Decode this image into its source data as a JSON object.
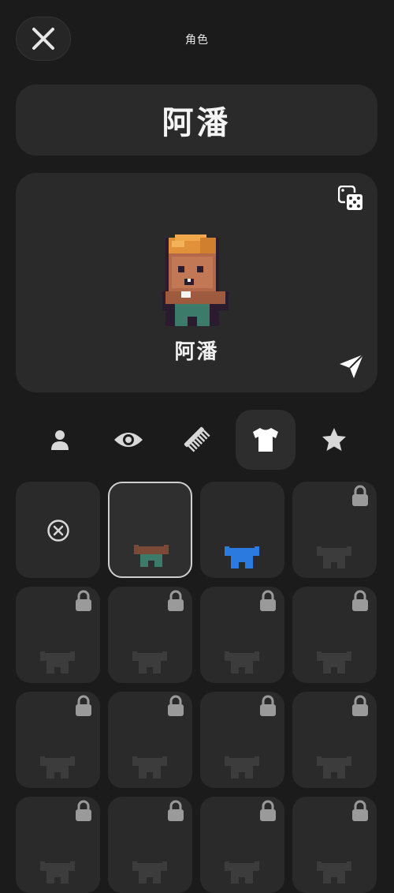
{
  "header": {
    "title": "角色"
  },
  "name_field": {
    "value": "阿潘"
  },
  "preview": {
    "character_name": "阿潘"
  },
  "tabs": [
    {
      "icon": "person-icon",
      "active": false
    },
    {
      "icon": "eye-icon",
      "active": false
    },
    {
      "icon": "comb-icon",
      "active": false
    },
    {
      "icon": "shirt-icon",
      "active": true
    },
    {
      "icon": "star-icon",
      "active": false
    }
  ],
  "outfits": [
    {
      "kind": "none",
      "locked": false,
      "selected": false,
      "color": null
    },
    {
      "kind": "outfit",
      "locked": false,
      "selected": true,
      "color": "#7a4a36",
      "pants": "#3c7a6a"
    },
    {
      "kind": "outfit",
      "locked": false,
      "selected": false,
      "color": "#2a7ae0",
      "pants": "#2a7ae0"
    },
    {
      "kind": "outfit",
      "locked": true,
      "selected": false,
      "color": "#3c3c3c"
    },
    {
      "kind": "outfit",
      "locked": true,
      "selected": false,
      "color": "#3c3c3c"
    },
    {
      "kind": "outfit",
      "locked": true,
      "selected": false,
      "color": "#3c3c3c"
    },
    {
      "kind": "outfit",
      "locked": true,
      "selected": false,
      "color": "#3c3c3c"
    },
    {
      "kind": "outfit",
      "locked": true,
      "selected": false,
      "color": "#3c3c3c"
    },
    {
      "kind": "outfit",
      "locked": true,
      "selected": false,
      "color": "#3c3c3c"
    },
    {
      "kind": "outfit",
      "locked": true,
      "selected": false,
      "color": "#3c3c3c"
    },
    {
      "kind": "outfit",
      "locked": true,
      "selected": false,
      "color": "#3c3c3c"
    },
    {
      "kind": "outfit",
      "locked": true,
      "selected": false,
      "color": "#3c3c3c"
    },
    {
      "kind": "outfit",
      "locked": true,
      "selected": false,
      "color": "#3c3c3c"
    },
    {
      "kind": "outfit",
      "locked": true,
      "selected": false,
      "color": "#3c3c3c"
    },
    {
      "kind": "outfit",
      "locked": true,
      "selected": false,
      "color": "#3c3c3c"
    },
    {
      "kind": "outfit",
      "locked": true,
      "selected": false,
      "color": "#3c3c3c"
    }
  ],
  "colors": {
    "background": "#1b1b1b",
    "card": "#2a2a2a",
    "icon": "#d8d8d8",
    "lock": "#9a9a9a"
  }
}
